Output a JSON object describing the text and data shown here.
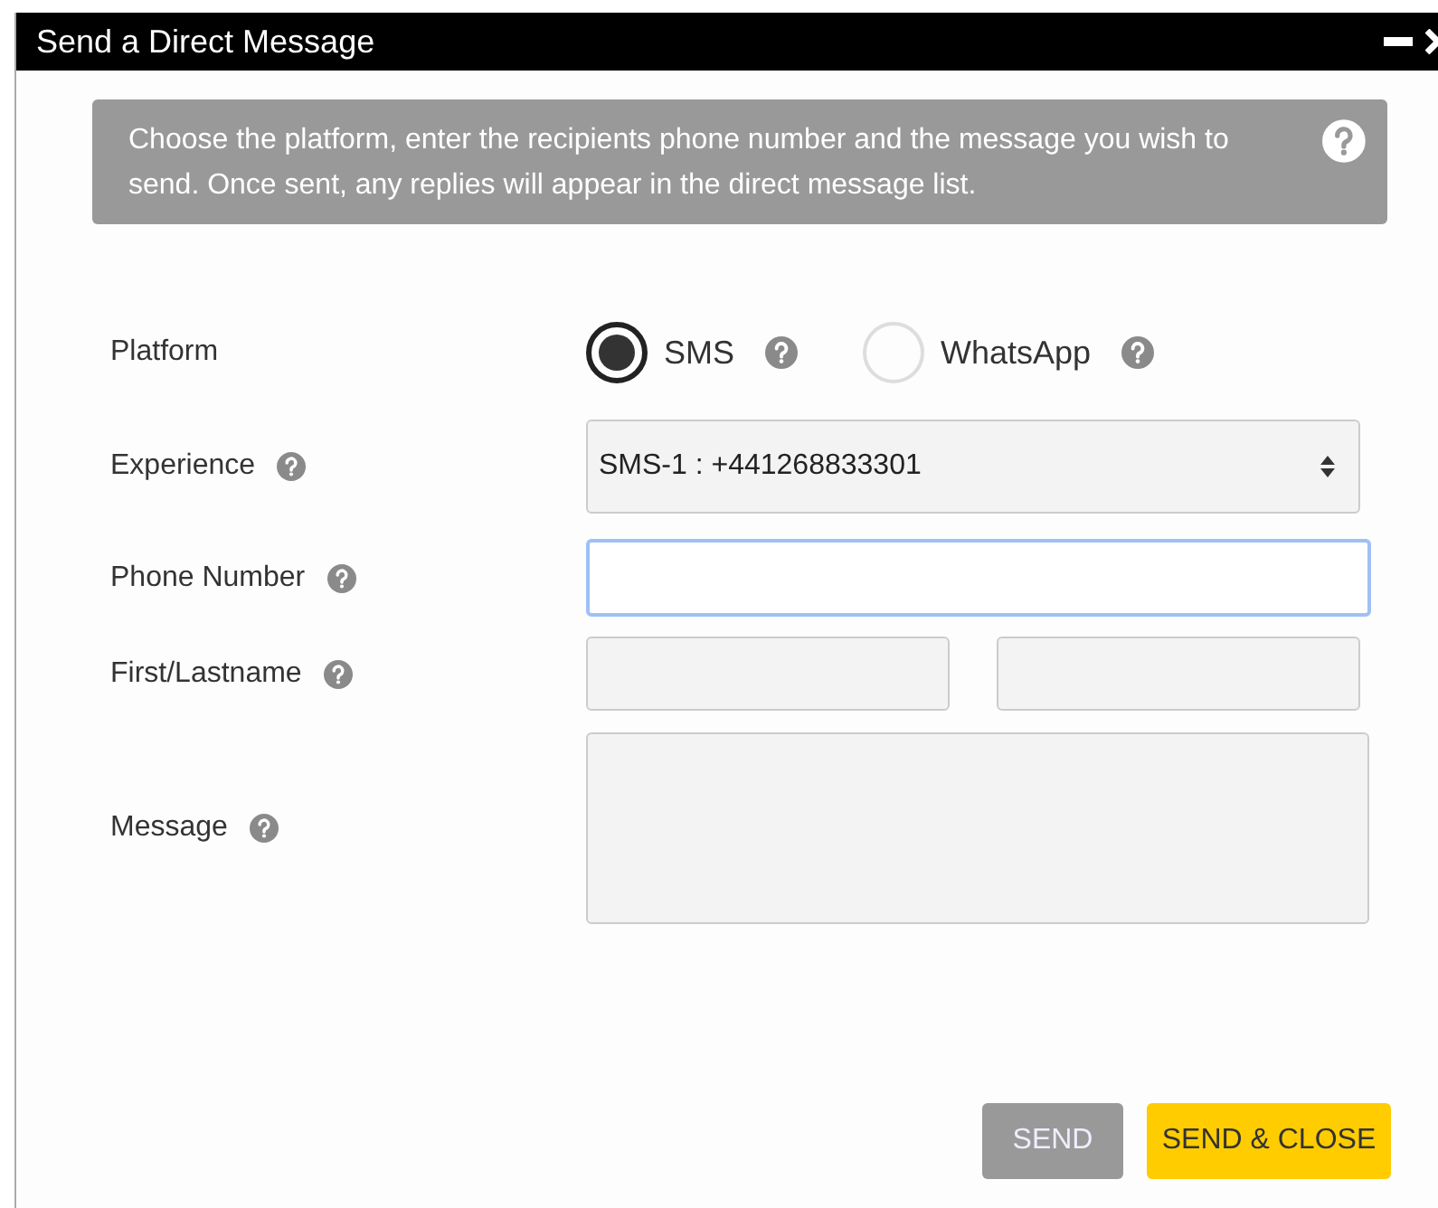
{
  "window": {
    "title": "Send a Direct Message"
  },
  "info": {
    "text": "Choose the platform, enter the recipients phone number and the message you wish to send. Once sent, any replies will appear in the direct message list."
  },
  "form": {
    "platform": {
      "label": "Platform",
      "options": [
        {
          "label": "SMS",
          "selected": true
        },
        {
          "label": "WhatsApp",
          "selected": false
        }
      ]
    },
    "experience": {
      "label": "Experience",
      "value": "SMS-1 : +441268833301"
    },
    "phone_number": {
      "label": "Phone Number",
      "focused": true
    },
    "name": {
      "label": "First/Lastname"
    },
    "message": {
      "label": "Message"
    }
  },
  "buttons": [
    {
      "label": "SEND",
      "kind": "secondary"
    },
    {
      "label": "SEND & CLOSE",
      "kind": "primary"
    }
  ]
}
